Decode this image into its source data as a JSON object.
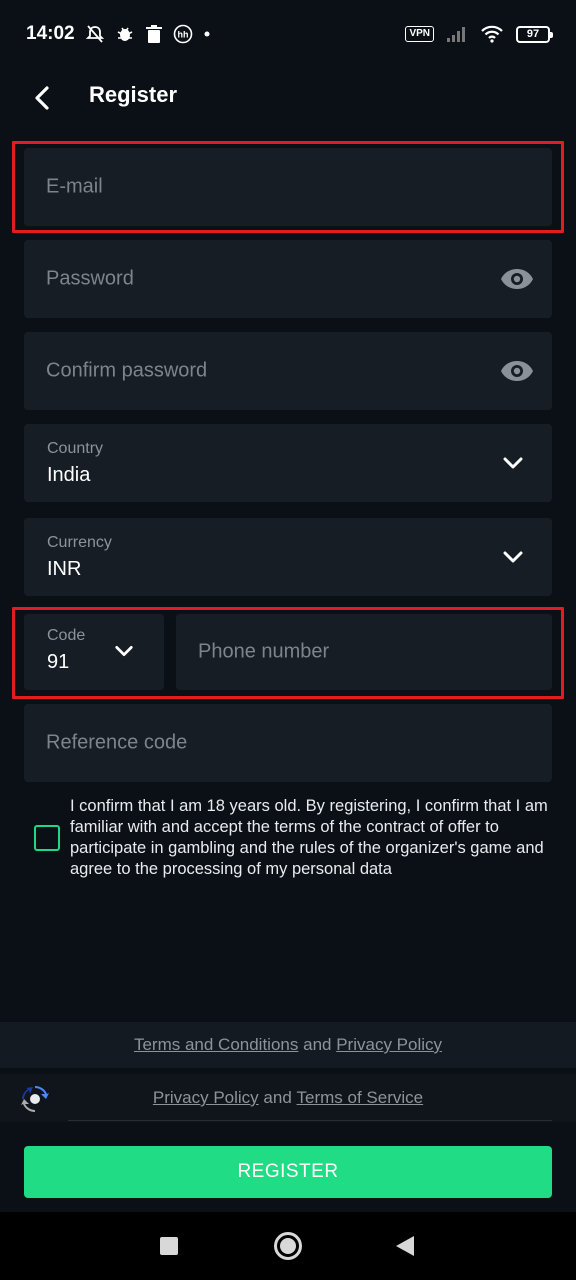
{
  "status_bar": {
    "time": "14:02",
    "icons": [
      "muted-bell-icon",
      "bug-icon",
      "trash-icon",
      "hh-icon",
      "dot-icon"
    ],
    "vpn_label": "VPN",
    "battery_level": "97"
  },
  "header": {
    "title": "Register",
    "back_icon": "chevron-left-icon"
  },
  "form": {
    "email_placeholder": "E-mail",
    "password_placeholder": "Password",
    "confirm_password_placeholder": "Confirm password",
    "country_label": "Country",
    "country_value": "India",
    "currency_label": "Currency",
    "currency_value": "INR",
    "code_label": "Code",
    "code_value": "91",
    "phone_placeholder": "Phone number",
    "reference_placeholder": "Reference code"
  },
  "consent_text": "I confirm that I am 18 years old. By registering, I confirm that I am familiar with and accept the terms of the contract of offer to participate in gambling and the rules of the organizer's game and agree to the processing of my personal data",
  "footer": {
    "terms_link": "Terms and Conditions",
    "and_1": "and",
    "privacy_link": "Privacy Policy",
    "recaptcha_privacy_link": "Privacy Policy",
    "and_2": "and",
    "terms_of_service_link": "Terms of Service"
  },
  "register_button": "REGISTER",
  "colors": {
    "background": "#0b1016",
    "field": "#171d25",
    "accent_green": "#1fdc85",
    "highlight_red": "#e11d22"
  }
}
